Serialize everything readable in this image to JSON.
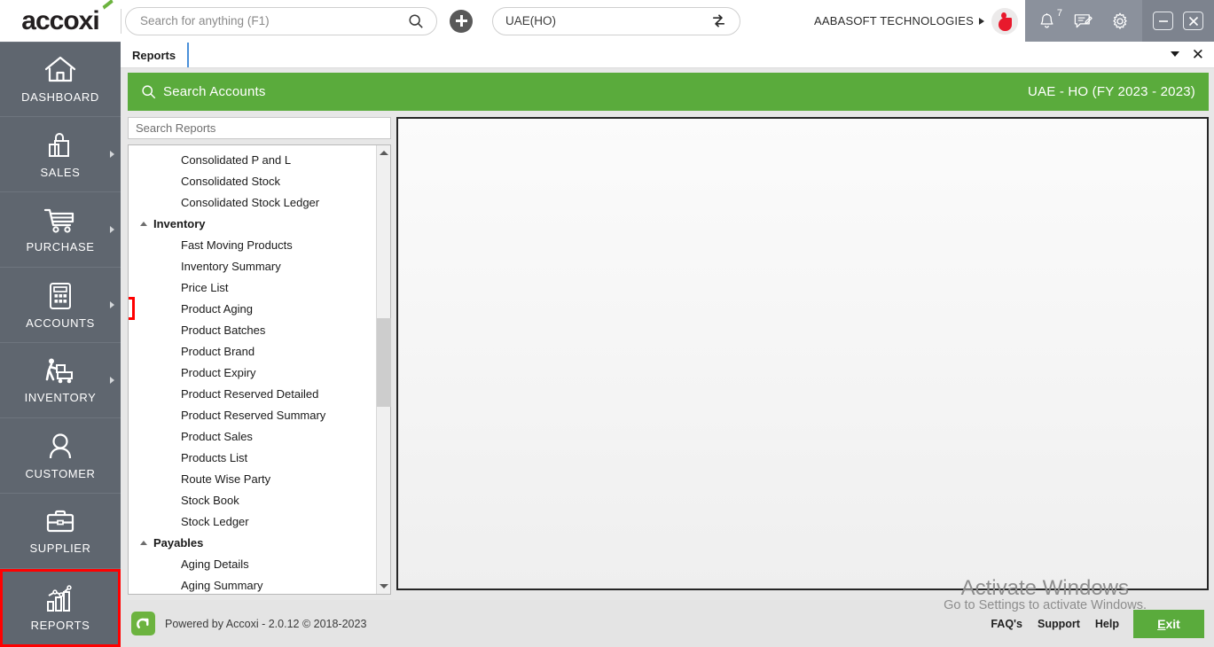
{
  "topbar": {
    "logo_text": "accoxi",
    "search": {
      "placeholder": "Search for anything (F1)",
      "value": ""
    },
    "add_button_label": "+",
    "branch": {
      "value": "UAE(HO)",
      "swap_icon": "swap-icon"
    },
    "organization": "AABASOFT TECHNOLOGIES",
    "notification_count": "7",
    "icons": {
      "search": "search-icon",
      "bell": "bell-icon",
      "message": "message-edit-icon",
      "settings": "gear-icon",
      "minimize": "minimize-icon",
      "close": "close-icon"
    }
  },
  "sidebar": {
    "items": [
      {
        "label": "DASHBOARD",
        "icon": "home-icon",
        "expandable": false,
        "highlighted": false
      },
      {
        "label": "SALES",
        "icon": "shopping-bag-icon",
        "expandable": true,
        "highlighted": false
      },
      {
        "label": "PURCHASE",
        "icon": "shopping-cart-icon",
        "expandable": true,
        "highlighted": false
      },
      {
        "label": "ACCOUNTS",
        "icon": "calculator-icon",
        "expandable": true,
        "highlighted": false
      },
      {
        "label": "INVENTORY",
        "icon": "warehouse-worker-icon",
        "expandable": true,
        "highlighted": false
      },
      {
        "label": "CUSTOMER",
        "icon": "person-icon",
        "expandable": false,
        "highlighted": false
      },
      {
        "label": "SUPPLIER",
        "icon": "briefcase-icon",
        "expandable": false,
        "highlighted": false
      },
      {
        "label": "REPORTS",
        "icon": "bar-chart-icon",
        "expandable": false,
        "highlighted": true
      }
    ]
  },
  "tabs": {
    "items": [
      {
        "label": "Reports",
        "active": true
      }
    ],
    "dropdown_icon": "chevron-down-icon",
    "close_label": "✕"
  },
  "page_header": {
    "search_icon": "search-icon",
    "title": "Search Accounts",
    "context": "UAE - HO (FY 2023 - 2023)",
    "accent_color": "#5aab3c"
  },
  "reports_panel": {
    "search": {
      "placeholder": "Search Reports",
      "value": ""
    },
    "tree": [
      {
        "type": "leaf",
        "label": "Consolidated P and L",
        "marked": false
      },
      {
        "type": "leaf",
        "label": "Consolidated Stock",
        "marked": false
      },
      {
        "type": "leaf",
        "label": "Consolidated Stock Ledger",
        "marked": false
      },
      {
        "type": "group",
        "label": "Inventory",
        "expanded": true
      },
      {
        "type": "leaf",
        "label": "Fast Moving Products",
        "marked": false
      },
      {
        "type": "leaf",
        "label": "Inventory Summary",
        "marked": false
      },
      {
        "type": "leaf",
        "label": "Price List",
        "marked": false
      },
      {
        "type": "leaf",
        "label": "Product Aging",
        "marked": true
      },
      {
        "type": "leaf",
        "label": "Product Batches",
        "marked": false
      },
      {
        "type": "leaf",
        "label": "Product Brand",
        "marked": false
      },
      {
        "type": "leaf",
        "label": "Product Expiry",
        "marked": false
      },
      {
        "type": "leaf",
        "label": "Product Reserved Detailed",
        "marked": false
      },
      {
        "type": "leaf",
        "label": "Product Reserved Summary",
        "marked": false
      },
      {
        "type": "leaf",
        "label": "Product Sales",
        "marked": false
      },
      {
        "type": "leaf",
        "label": "Products List",
        "marked": false
      },
      {
        "type": "leaf",
        "label": "Route Wise Party",
        "marked": false
      },
      {
        "type": "leaf",
        "label": "Stock Book",
        "marked": false
      },
      {
        "type": "leaf",
        "label": "Stock Ledger",
        "marked": false
      },
      {
        "type": "group",
        "label": "Payables",
        "expanded": true
      },
      {
        "type": "leaf",
        "label": "Aging Details",
        "marked": false
      },
      {
        "type": "leaf",
        "label": "Aging Summary",
        "marked": false
      }
    ]
  },
  "footer": {
    "powered_by": "Powered by Accoxi - 2.0.12 © 2018-2023",
    "links": [
      "FAQ's",
      "Support",
      "Help"
    ],
    "exit_prefix": "E",
    "exit_suffix": "xit"
  },
  "watermark": {
    "title": "Activate Windows",
    "subtitle": "Go to Settings to activate Windows."
  }
}
